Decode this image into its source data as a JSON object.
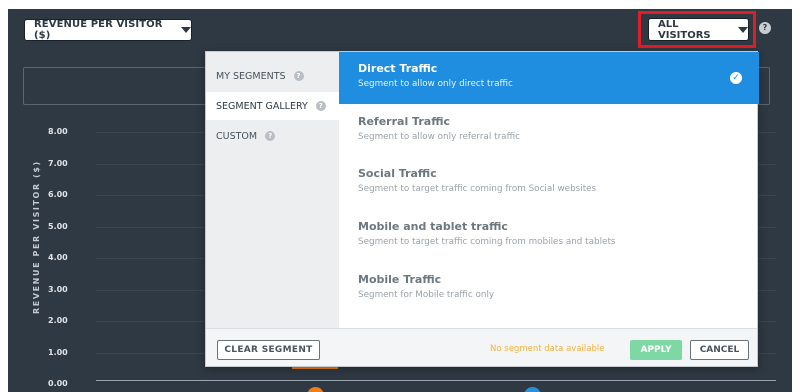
{
  "toolbar": {
    "metric_label": "REVENUE PER VISITOR ($)",
    "audience_label": "ALL VISITORS",
    "help_glyph": "?"
  },
  "chart": {
    "ylabel": "REVENUE PER VISITOR ($)",
    "yticks": [
      "8.00",
      "7.00",
      "6.00",
      "5.00",
      "4.00",
      "3.00",
      "2.00",
      "1.00",
      "0.00"
    ]
  },
  "segments_menu": {
    "tabs": [
      {
        "label": "MY SEGMENTS",
        "active": false
      },
      {
        "label": "SEGMENT GALLERY",
        "active": true
      },
      {
        "label": "CUSTOM",
        "active": false
      }
    ],
    "items": [
      {
        "title": "Direct Traffic",
        "description": "Segment to allow only direct traffic",
        "selected": true
      },
      {
        "title": "Referral Traffic",
        "description": "Segment to allow only referral traffic",
        "selected": false
      },
      {
        "title": "Social Traffic",
        "description": "Segment to target traffic coming from Social websites",
        "selected": false
      },
      {
        "title": "Mobile and tablet traffic",
        "description": "Segment to target traffic coming from mobiles and tablets",
        "selected": false
      },
      {
        "title": "Mobile Traffic",
        "description": "Segment for Mobile traffic only",
        "selected": false
      }
    ],
    "footer": {
      "clear_label": "CLEAR SEGMENT",
      "status_text": "No segment data available",
      "apply_label": "APPLY",
      "cancel_label": "CANCEL"
    }
  },
  "colors": {
    "background": "#2f3943",
    "accent": "#1f8ee0",
    "highlight": "#e01e26",
    "warning": "#f5b23d",
    "apply": "#7ed8a3",
    "series_orange": "#f07d1a",
    "series_blue": "#2b8fd6"
  },
  "icons": {
    "dropdown": "caret-down-icon",
    "help": "question-icon",
    "check": "check-circle-icon"
  }
}
